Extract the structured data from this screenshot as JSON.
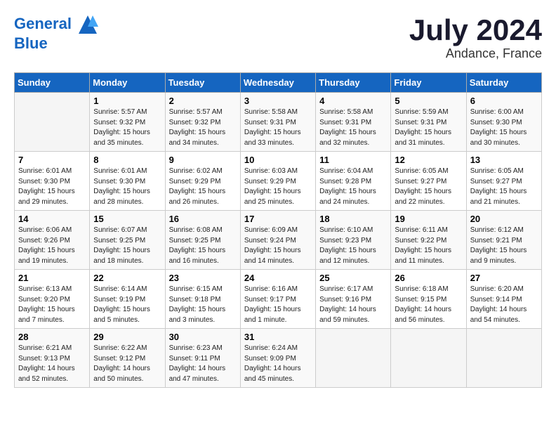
{
  "header": {
    "logo_line1": "General",
    "logo_line2": "Blue",
    "month": "July 2024",
    "location": "Andance, France"
  },
  "weekdays": [
    "Sunday",
    "Monday",
    "Tuesday",
    "Wednesday",
    "Thursday",
    "Friday",
    "Saturday"
  ],
  "weeks": [
    [
      {
        "day": "",
        "info": ""
      },
      {
        "day": "1",
        "info": "Sunrise: 5:57 AM\nSunset: 9:32 PM\nDaylight: 15 hours\nand 35 minutes."
      },
      {
        "day": "2",
        "info": "Sunrise: 5:57 AM\nSunset: 9:32 PM\nDaylight: 15 hours\nand 34 minutes."
      },
      {
        "day": "3",
        "info": "Sunrise: 5:58 AM\nSunset: 9:31 PM\nDaylight: 15 hours\nand 33 minutes."
      },
      {
        "day": "4",
        "info": "Sunrise: 5:58 AM\nSunset: 9:31 PM\nDaylight: 15 hours\nand 32 minutes."
      },
      {
        "day": "5",
        "info": "Sunrise: 5:59 AM\nSunset: 9:31 PM\nDaylight: 15 hours\nand 31 minutes."
      },
      {
        "day": "6",
        "info": "Sunrise: 6:00 AM\nSunset: 9:30 PM\nDaylight: 15 hours\nand 30 minutes."
      }
    ],
    [
      {
        "day": "7",
        "info": "Sunrise: 6:01 AM\nSunset: 9:30 PM\nDaylight: 15 hours\nand 29 minutes."
      },
      {
        "day": "8",
        "info": "Sunrise: 6:01 AM\nSunset: 9:30 PM\nDaylight: 15 hours\nand 28 minutes."
      },
      {
        "day": "9",
        "info": "Sunrise: 6:02 AM\nSunset: 9:29 PM\nDaylight: 15 hours\nand 26 minutes."
      },
      {
        "day": "10",
        "info": "Sunrise: 6:03 AM\nSunset: 9:29 PM\nDaylight: 15 hours\nand 25 minutes."
      },
      {
        "day": "11",
        "info": "Sunrise: 6:04 AM\nSunset: 9:28 PM\nDaylight: 15 hours\nand 24 minutes."
      },
      {
        "day": "12",
        "info": "Sunrise: 6:05 AM\nSunset: 9:27 PM\nDaylight: 15 hours\nand 22 minutes."
      },
      {
        "day": "13",
        "info": "Sunrise: 6:05 AM\nSunset: 9:27 PM\nDaylight: 15 hours\nand 21 minutes."
      }
    ],
    [
      {
        "day": "14",
        "info": "Sunrise: 6:06 AM\nSunset: 9:26 PM\nDaylight: 15 hours\nand 19 minutes."
      },
      {
        "day": "15",
        "info": "Sunrise: 6:07 AM\nSunset: 9:25 PM\nDaylight: 15 hours\nand 18 minutes."
      },
      {
        "day": "16",
        "info": "Sunrise: 6:08 AM\nSunset: 9:25 PM\nDaylight: 15 hours\nand 16 minutes."
      },
      {
        "day": "17",
        "info": "Sunrise: 6:09 AM\nSunset: 9:24 PM\nDaylight: 15 hours\nand 14 minutes."
      },
      {
        "day": "18",
        "info": "Sunrise: 6:10 AM\nSunset: 9:23 PM\nDaylight: 15 hours\nand 12 minutes."
      },
      {
        "day": "19",
        "info": "Sunrise: 6:11 AM\nSunset: 9:22 PM\nDaylight: 15 hours\nand 11 minutes."
      },
      {
        "day": "20",
        "info": "Sunrise: 6:12 AM\nSunset: 9:21 PM\nDaylight: 15 hours\nand 9 minutes."
      }
    ],
    [
      {
        "day": "21",
        "info": "Sunrise: 6:13 AM\nSunset: 9:20 PM\nDaylight: 15 hours\nand 7 minutes."
      },
      {
        "day": "22",
        "info": "Sunrise: 6:14 AM\nSunset: 9:19 PM\nDaylight: 15 hours\nand 5 minutes."
      },
      {
        "day": "23",
        "info": "Sunrise: 6:15 AM\nSunset: 9:18 PM\nDaylight: 15 hours\nand 3 minutes."
      },
      {
        "day": "24",
        "info": "Sunrise: 6:16 AM\nSunset: 9:17 PM\nDaylight: 15 hours\nand 1 minute."
      },
      {
        "day": "25",
        "info": "Sunrise: 6:17 AM\nSunset: 9:16 PM\nDaylight: 14 hours\nand 59 minutes."
      },
      {
        "day": "26",
        "info": "Sunrise: 6:18 AM\nSunset: 9:15 PM\nDaylight: 14 hours\nand 56 minutes."
      },
      {
        "day": "27",
        "info": "Sunrise: 6:20 AM\nSunset: 9:14 PM\nDaylight: 14 hours\nand 54 minutes."
      }
    ],
    [
      {
        "day": "28",
        "info": "Sunrise: 6:21 AM\nSunset: 9:13 PM\nDaylight: 14 hours\nand 52 minutes."
      },
      {
        "day": "29",
        "info": "Sunrise: 6:22 AM\nSunset: 9:12 PM\nDaylight: 14 hours\nand 50 minutes."
      },
      {
        "day": "30",
        "info": "Sunrise: 6:23 AM\nSunset: 9:11 PM\nDaylight: 14 hours\nand 47 minutes."
      },
      {
        "day": "31",
        "info": "Sunrise: 6:24 AM\nSunset: 9:09 PM\nDaylight: 14 hours\nand 45 minutes."
      },
      {
        "day": "",
        "info": ""
      },
      {
        "day": "",
        "info": ""
      },
      {
        "day": "",
        "info": ""
      }
    ]
  ]
}
